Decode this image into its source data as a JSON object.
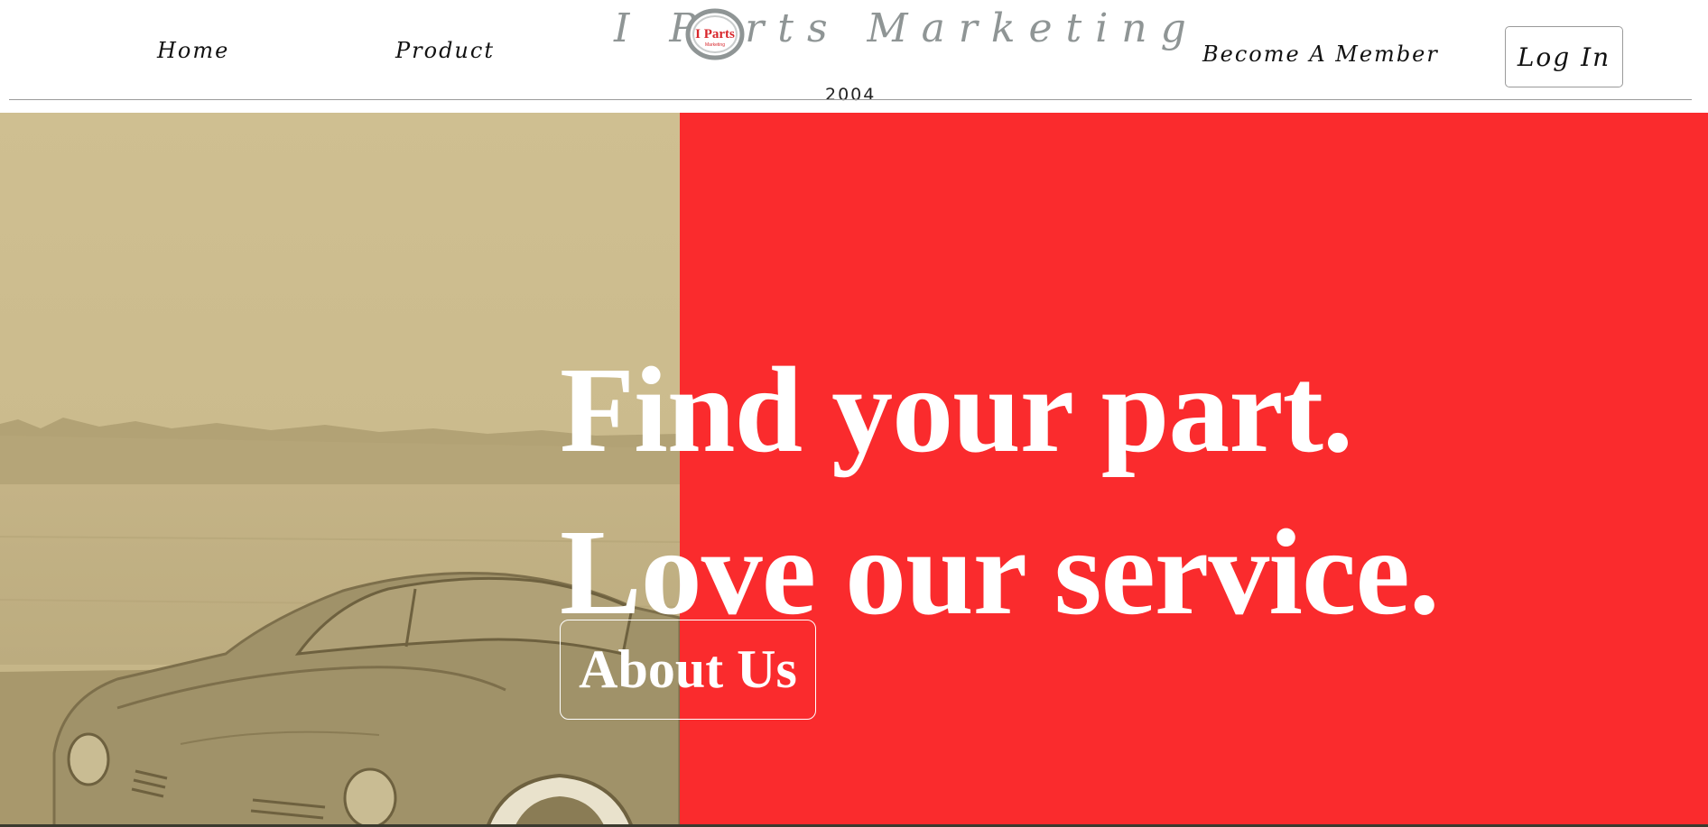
{
  "header": {
    "nav": {
      "home": "Home",
      "product": "Product",
      "become_member": "Become A Member"
    },
    "brand": {
      "name": "I Parts Marketing",
      "badge_text": "I Parts",
      "badge_subtext": "Marketing",
      "year": "2004"
    },
    "login_label": "Log In"
  },
  "hero": {
    "headline_line1": "Find your part.",
    "headline_line2": "Love our service.",
    "about_label": "About Us",
    "photo_icon": "classic-car-photo"
  },
  "colors": {
    "accent_red": "#fa2b2d",
    "photo_sepia": "#cdbd8f",
    "brand_gray": "#8f9595",
    "badge_red": "#d8262b"
  }
}
